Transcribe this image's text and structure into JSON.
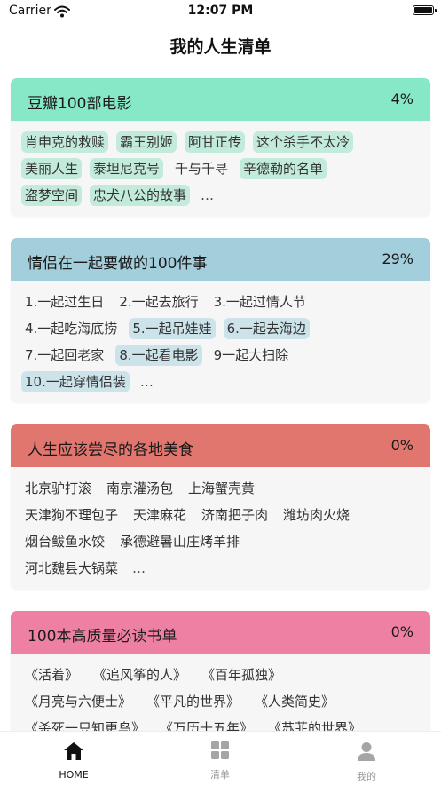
{
  "status": {
    "carrier": "Carrier",
    "time": "12:07 PM"
  },
  "nav": {
    "title": "我的人生清单"
  },
  "cards": [
    {
      "title": "豆瓣100部电影",
      "percent": "4%",
      "head_color": "#87E8C7",
      "tag_color": "#C3EBDC",
      "rows": [
        [
          {
            "t": "肖申克的救赎",
            "h": true
          },
          {
            "t": "霸王别姬",
            "h": true
          },
          {
            "t": "阿甘正传",
            "h": true
          },
          {
            "t": "这个杀手不太冷",
            "h": true
          }
        ],
        [
          {
            "t": "美丽人生",
            "h": true
          },
          {
            "t": "泰坦尼克号",
            "h": true
          },
          {
            "t": "千与千寻",
            "h": false
          },
          {
            "t": "辛德勒的名单",
            "h": true
          }
        ],
        [
          {
            "t": "盗梦空间",
            "h": true
          },
          {
            "t": "忠犬八公的故事",
            "h": true
          },
          {
            "t": "…",
            "more": true
          }
        ]
      ]
    },
    {
      "title": "情侣在一起要做的100件事",
      "percent": "29%",
      "head_color": "#A3CEDB",
      "tag_color": "#CCE3EA",
      "rows": [
        [
          {
            "t": "1.一起过生日",
            "h": false
          },
          {
            "t": "2.一起去旅行",
            "h": false
          },
          {
            "t": "3.一起过情人节",
            "h": false
          }
        ],
        [
          {
            "t": "4.一起吃海底捞",
            "h": false
          },
          {
            "t": "5.一起吊娃娃",
            "h": true
          },
          {
            "t": "6.一起去海边",
            "h": true
          }
        ],
        [
          {
            "t": "7.一起回老家",
            "h": false
          },
          {
            "t": "8.一起看电影",
            "h": true
          },
          {
            "t": "9一起大扫除",
            "h": false
          }
        ],
        [
          {
            "t": "10.一起穿情侣装",
            "h": true
          },
          {
            "t": "…",
            "more": true
          }
        ]
      ]
    },
    {
      "title": "人生应该尝尽的各地美食",
      "percent": "0%",
      "head_color": "#E0766E",
      "tag_color": "#F2C6C2",
      "rows": [
        [
          {
            "t": "北京驴打滚",
            "h": false
          },
          {
            "t": "南京灌汤包",
            "h": false
          },
          {
            "t": "上海蟹壳黄",
            "h": false
          }
        ],
        [
          {
            "t": "天津狗不理包子",
            "h": false
          },
          {
            "t": "天津麻花",
            "h": false
          },
          {
            "t": "济南把子肉",
            "h": false
          },
          {
            "t": "潍坊肉火烧",
            "h": false
          }
        ],
        [
          {
            "t": "烟台鲅鱼水饺",
            "h": false
          },
          {
            "t": "承德避暑山庄烤羊排",
            "h": false
          }
        ],
        [
          {
            "t": "河北魏县大锅菜",
            "h": false
          },
          {
            "t": "…",
            "more": true
          }
        ]
      ]
    },
    {
      "title": "100本高质量必读书单",
      "percent": "0%",
      "head_color": "#EE80A4",
      "tag_color": "#F6CADA",
      "rows": [
        [
          {
            "t": "《活着》",
            "h": false
          },
          {
            "t": "《追风筝的人》",
            "h": false
          },
          {
            "t": "《百年孤独》",
            "h": false
          }
        ],
        [
          {
            "t": "《月亮与六便士》",
            "h": false
          },
          {
            "t": "《平凡的世界》",
            "h": false
          },
          {
            "t": "《人类简史》",
            "h": false
          }
        ],
        [
          {
            "t": "《杀死一只知更鸟》",
            "h": false
          },
          {
            "t": "《万历十五年》",
            "h": false
          },
          {
            "t": "《苏菲的世界》",
            "h": false
          }
        ]
      ]
    }
  ],
  "tabs": [
    {
      "label": "HOME",
      "icon": "home-icon",
      "active": true
    },
    {
      "label": "清单",
      "icon": "grid-icon",
      "active": false
    },
    {
      "label": "我的",
      "icon": "person-icon",
      "active": false
    }
  ],
  "colors": {
    "tab_active": "#111111",
    "tab_inactive": "#9a9a9a"
  }
}
